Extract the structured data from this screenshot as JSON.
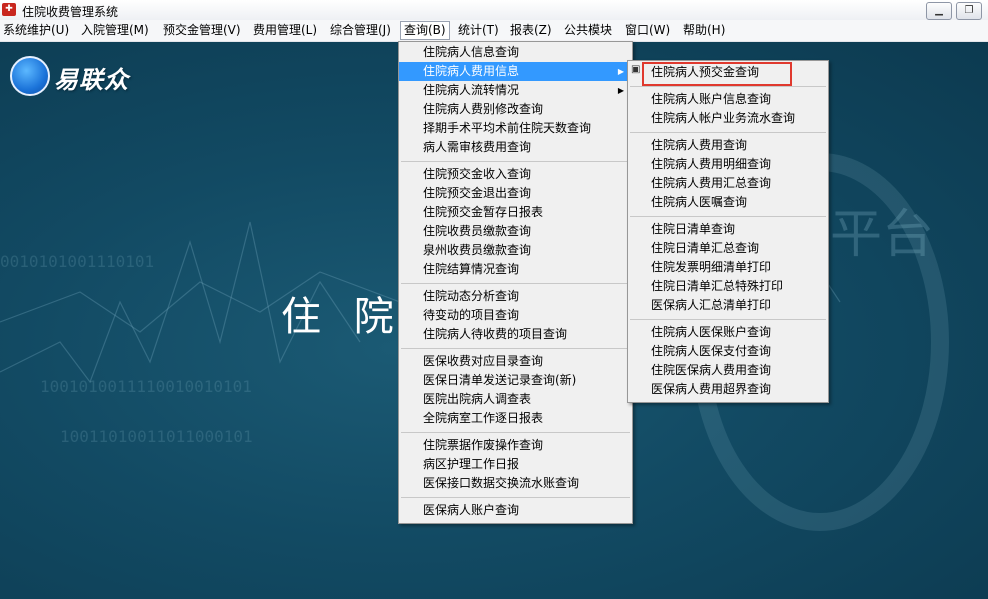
{
  "window": {
    "title": "住院收费管理系统",
    "icon": "app-icon"
  },
  "menubar": {
    "items": [
      {
        "label": "系统维护(U)"
      },
      {
        "label": "入院管理(M)"
      },
      {
        "label": "预交金管理(V)"
      },
      {
        "label": "费用管理(L)"
      },
      {
        "label": "综合管理(J)"
      },
      {
        "label": "查询(B)"
      },
      {
        "label": "统计(T)"
      },
      {
        "label": "报表(Z)"
      },
      {
        "label": "公共模块"
      },
      {
        "label": "窗口(W)"
      },
      {
        "label": "帮助(H)"
      }
    ]
  },
  "main": {
    "logo_text": "易联众",
    "hero_text": "住 院",
    "bg_words": "平台"
  },
  "query_menu": {
    "items": [
      "住院病人信息查询",
      "住院病人费用信息",
      "住院病人流转情况",
      "住院病人费别修改查询",
      "择期手术平均术前住院天数查询",
      "病人需审核费用查询",
      "住院预交金收入查询",
      "住院预交金退出查询",
      "住院预交金暂存日报表",
      "住院收费员缴款查询",
      "泉州收费员缴款查询",
      "住院结算情况查询",
      "住院动态分析查询",
      "待变动的项目查询",
      "住院病人待收费的项目查询",
      "医保收费对应目录查询",
      "医保日清单发送记录查询(新)",
      "医院出院病人调查表",
      "全院病室工作逐日报表",
      "住院票据作废操作查询",
      "病区护理工作日报",
      "医保接口数据交换流水账查询",
      "医保病人账户查询"
    ]
  },
  "sub_menu": {
    "items": [
      "住院病人预交金查询",
      "住院病人账户信息查询",
      "住院病人帐户业务流水查询",
      "住院病人费用查询",
      "住院病人费用明细查询",
      "住院病人费用汇总查询",
      "住院病人医嘱查询",
      "住院日清单查询",
      "住院日清单汇总查询",
      "住院发票明细清单打印",
      "住院日清单汇总特殊打印",
      "医保病人汇总清单打印",
      "住院病人医保账户查询",
      "住院病人医保支付查询",
      "住院医保病人费用查询",
      "医保病人费用超界查询"
    ]
  },
  "colors": {
    "highlight": "#3399ff",
    "background": "#124a63",
    "selection_box": "#e0392e"
  }
}
